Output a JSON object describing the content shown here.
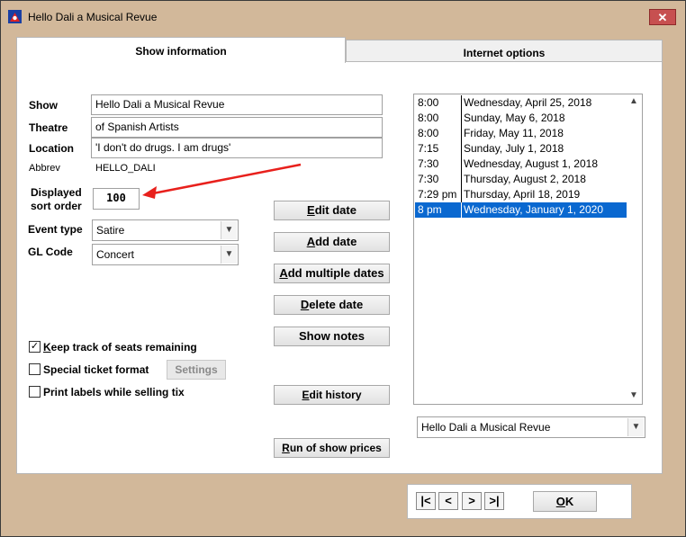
{
  "window": {
    "title": "Hello Dali  a Musical Revue",
    "close_glyph": "✕"
  },
  "tabs": [
    {
      "label": "Show information"
    },
    {
      "label": "Internet options"
    }
  ],
  "form": {
    "show_label": "Show",
    "show_value": "Hello Dali  a Musical Revue",
    "theatre_label": "Theatre",
    "theatre_value": "of Spanish Artists",
    "location_label": "Location",
    "location_value": "'I don't do drugs. I am drugs'",
    "abbrev_label": "Abbrev",
    "abbrev_value": "HELLO_DALI",
    "sort_label_line1": "Displayed",
    "sort_label_line2": "sort order",
    "sort_value": "100",
    "event_type_label": "Event type",
    "event_type_value": "Satire",
    "gl_code_label": "GL Code",
    "gl_code_value": "Concert"
  },
  "checkboxes": [
    {
      "label_u": "K",
      "label_rest": "eep track of seats remaining",
      "checked": true
    },
    {
      "label_u": "",
      "label_rest": "Special ticket format",
      "checked": false
    },
    {
      "label_u": "",
      "label_rest": "Print labels while selling tix",
      "checked": false
    }
  ],
  "settings_button": "Settings",
  "buttons": {
    "edit_date_u": "E",
    "edit_date_rest": "dit date",
    "add_date_u": "A",
    "add_date_rest": "dd date",
    "add_multiple_u": "A",
    "add_multiple_rest": "dd multiple dates",
    "delete_date_u": "D",
    "delete_date_rest": "elete date",
    "show_notes": "Show notes",
    "edit_history_u": "E",
    "edit_history_rest": "dit history",
    "run_prices_u": "R",
    "run_prices_rest": "un of show prices"
  },
  "dates": [
    {
      "time": "8:00",
      "date": "Wednesday, April 25, 2018"
    },
    {
      "time": "8:00",
      "date": "Sunday, May 6, 2018"
    },
    {
      "time": "8:00",
      "date": "Friday, May 11, 2018"
    },
    {
      "time": "7:15",
      "date": "Sunday, July 1, 2018"
    },
    {
      "time": "7:30",
      "date": "Wednesday, August 1, 2018"
    },
    {
      "time": "7:30",
      "date": "Thursday, August 2, 2018"
    },
    {
      "time": "7:29 pm",
      "date": "Thursday, April 18, 2019"
    },
    {
      "time": "8 pm",
      "date": "Wednesday, January 1, 2020",
      "selected": true
    }
  ],
  "show_select_value": "Hello Dali  a Musical Revue",
  "nav": {
    "first": "|<",
    "prev": "<",
    "next": ">",
    "last": ">|",
    "ok_u": "O",
    "ok_rest": "K"
  },
  "icons": {
    "app": "theatre-icon",
    "close": "close-icon",
    "dropdown": "chevron-down-icon",
    "scroll_up": "chevron-up-icon",
    "scroll_down": "chevron-down-icon"
  },
  "colors": {
    "frame": "#d2b89a",
    "selection": "#0a68d0",
    "annotation_arrow": "#e8201c"
  }
}
